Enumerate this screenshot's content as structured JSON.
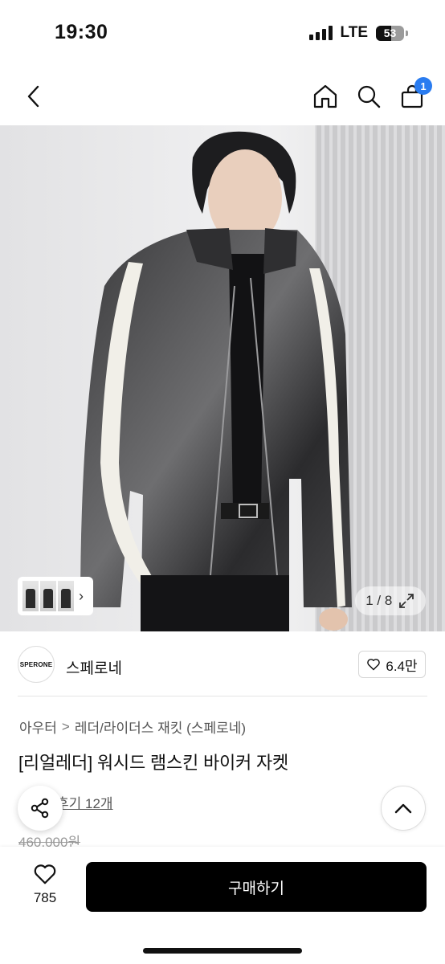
{
  "status_bar": {
    "time": "19:30",
    "network": "LTE",
    "battery_level": "53",
    "battery_fraction": 0.53,
    "signal_bars": 4
  },
  "nav": {
    "icons": [
      "back-icon",
      "home-icon",
      "search-icon",
      "cart-icon"
    ],
    "cart_badge": "1"
  },
  "gallery": {
    "counter": "1 / 8",
    "current": 1,
    "total": 8
  },
  "brand": {
    "logo_text": "SPERONE",
    "name": "스페로네",
    "likes": "6.4만"
  },
  "product": {
    "category_parent": "아우터",
    "category_separator": ">",
    "category_child": "레더/라이더스 재킷 (스페로네)",
    "title": "[리얼레더] 워시드 램스킨 바이커 자켓",
    "reviews_text": "후기 12개",
    "original_price": "460,000원"
  },
  "bottom_bar": {
    "wish_count": "785",
    "buy_label": "구매하기"
  },
  "colors": {
    "accent_badge": "#2a7cf0",
    "buy_button": "#000000"
  }
}
